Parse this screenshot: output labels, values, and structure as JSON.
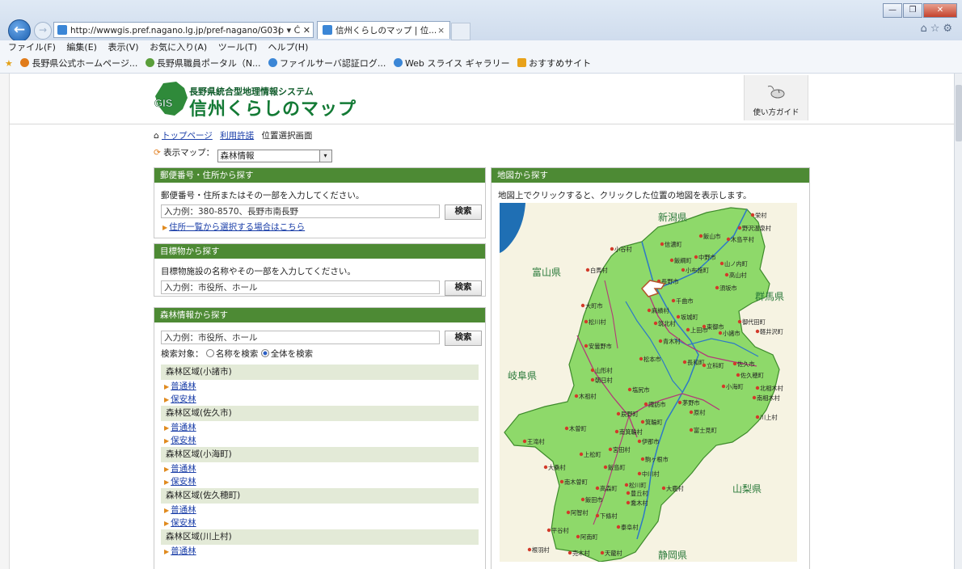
{
  "browser": {
    "url": "http://wwwgis.pref.nagano.lg.jp/pref-nagano/G03(",
    "address_controls": "ρ ▾ Ċ ✕",
    "tab_title": "信州くらしのマップ | 位...",
    "tab_close": "×",
    "win_min": "—",
    "win_max": "❐",
    "win_close": "✕",
    "tool_icons": "⌂☆⚙",
    "back_glyph": "←",
    "forward_glyph": "→",
    "menu": [
      "ファイル(F)",
      "編集(E)",
      "表示(V)",
      "お気に入り(A)",
      "ツール(T)",
      "ヘルプ(H)"
    ],
    "favorites": [
      "長野県公式ホームページ...",
      "長野県職員ポータル（N...",
      "ファイルサーバ認証ログ...",
      "Web スライス ギャラリー",
      "おすすめサイト"
    ]
  },
  "site": {
    "logo_sub": "長野県統合型地理情報システム",
    "logo_main": "信州くらしのマップ",
    "logo_badge": "GIS",
    "guide_label": "使い方ガイド",
    "breadcrumb": {
      "home": "トップページ",
      "terms": "利用許諾",
      "current": "位置選択画面"
    },
    "display_map_label": "表示マップ：",
    "display_map_value": "森林情報",
    "select_arrow": "▾"
  },
  "postal_panel": {
    "title": "郵便番号・住所から探す",
    "instruction": "郵便番号・住所またはその一部を入力してください。",
    "placeholder": "入力例：380-8570、長野市南長野",
    "button": "検索",
    "link": "住所一覧から選択する場合はこちら"
  },
  "landmark_panel": {
    "title": "目標物から探す",
    "instruction": "目標物施設の名称やその一部を入力してください。",
    "placeholder": "入力例：市役所、ホール",
    "button": "検索"
  },
  "forest_panel": {
    "title": "森林情報から探す",
    "placeholder": "入力例：市役所、ホール",
    "button": "検索",
    "target_label": "検索対象：",
    "radio_name": "名称を検索",
    "radio_all": "全体を検索",
    "areas": [
      {
        "name": "森林区域(小諸市)",
        "links": [
          "普通林",
          "保安林"
        ]
      },
      {
        "name": "森林区域(佐久市)",
        "links": [
          "普通林",
          "保安林"
        ]
      },
      {
        "name": "森林区域(小海町)",
        "links": [
          "普通林",
          "保安林"
        ]
      },
      {
        "name": "森林区域(佐久穂町)",
        "links": [
          "普通林",
          "保安林"
        ]
      },
      {
        "name": "森林区域(川上村)",
        "links": [
          "普通林"
        ]
      }
    ]
  },
  "map_panel": {
    "title": "地図から探す",
    "instruction": "地図上でクリックすると、クリックした位置の地図を表示します。",
    "regions": {
      "niigata": "新潟県",
      "toyama": "富山県",
      "gunma": "群馬県",
      "gifu": "岐阜県",
      "yamanashi": "山梨県",
      "shizuoka": "静岡県"
    },
    "cities": [
      "栄村",
      "野沢温泉村",
      "飯山市",
      "木島平村",
      "小谷村",
      "信濃町",
      "中野市",
      "山ノ内町",
      "飯綱町",
      "白馬村",
      "小布施町",
      "高山村",
      "須坂市",
      "長野市",
      "千曲市",
      "大町市",
      "麻績村",
      "坂城町",
      "松川村",
      "筑北村",
      "上田市",
      "東御市",
      "御代田町",
      "軽井沢町",
      "小諸市",
      "安曇野市",
      "青木村",
      "松本市",
      "長和町",
      "立科町",
      "佐久市",
      "山形村",
      "朝日村",
      "佐久穂町",
      "小海町",
      "北相木村",
      "南相木村",
      "塩尻市",
      "諏訪市",
      "茅野市",
      "原村",
      "川上村",
      "木祖村",
      "辰野町",
      "箕輪町",
      "南箕輪村",
      "伊那市",
      "富士見町",
      "王滝村",
      "木曽町",
      "宮田村",
      "上松町",
      "駒ヶ根市",
      "大桑村",
      "飯島町",
      "中川村",
      "南木曽町",
      "高森町",
      "松川町",
      "大鹿村",
      "豊丘村",
      "飯田市",
      "喬木村",
      "阿智村",
      "下條村",
      "泰阜村",
      "平谷村",
      "阿南町",
      "根羽村",
      "売木村",
      "天龍村"
    ]
  }
}
